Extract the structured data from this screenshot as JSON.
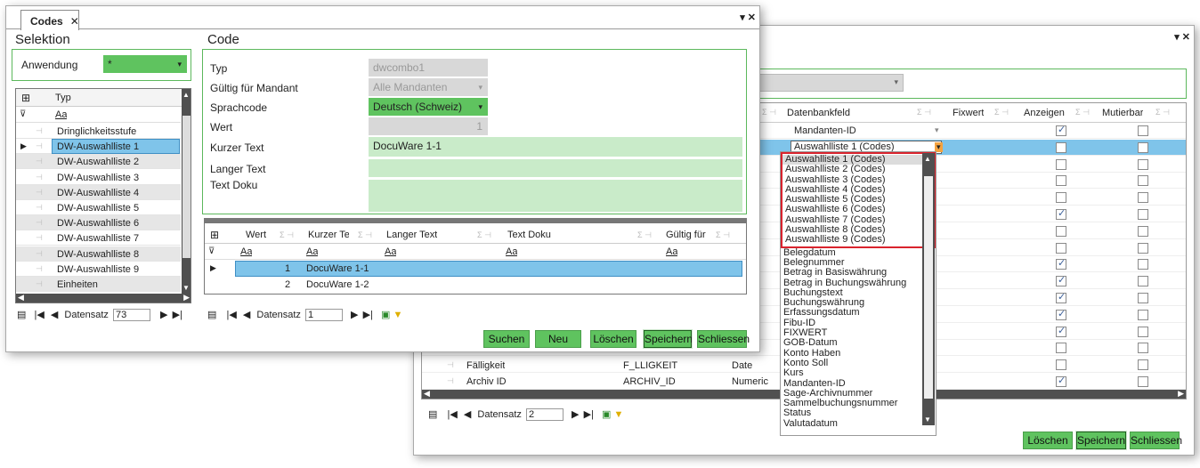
{
  "back_window": {
    "window_controls": "▾ ✕",
    "grid": {
      "columns": [
        {
          "label": "Datenbankfeld"
        },
        {
          "label": "Fixwert"
        },
        {
          "label": "Anzeigen"
        },
        {
          "label": "Mutierbar"
        }
      ],
      "sigma_pin": "Σ ⊣",
      "rows": [
        {
          "db": "Mandanten-ID",
          "anzeigen": true,
          "mutierbar": false
        },
        {
          "db": "Auswahlliste 1 (Codes)",
          "anzeigen": false,
          "mutierbar": false
        },
        {
          "anzeigen": false,
          "mutierbar": false
        },
        {
          "anzeigen": false,
          "mutierbar": false
        },
        {
          "anzeigen": false,
          "mutierbar": false
        },
        {
          "anzeigen": true,
          "mutierbar": false
        },
        {
          "anzeigen": false,
          "mutierbar": false
        },
        {
          "anzeigen": false,
          "mutierbar": false
        },
        {
          "anzeigen": true,
          "mutierbar": false
        },
        {
          "anzeigen": true,
          "mutierbar": false
        },
        {
          "anzeigen": true,
          "mutierbar": false
        },
        {
          "anzeigen": true,
          "mutierbar": false
        },
        {
          "anzeigen": true,
          "mutierbar": false
        },
        {
          "anzeigen": false,
          "mutierbar": false
        },
        {
          "anzeigen": false,
          "mutierbar": false
        },
        {
          "anzeigen": true,
          "mutierbar": false
        },
        {
          "anzeigen": true,
          "mutierbar": false
        }
      ],
      "visible_rows": [
        {
          "name": "Fälligkeit",
          "field": "F_LLIGKEIT",
          "type": "Date"
        },
        {
          "name": "Archiv ID",
          "field": "ARCHIV_ID",
          "type": "Numeric"
        }
      ]
    },
    "dropdown": {
      "highlighted": [
        "Auswahlliste 1 (Codes)",
        "Auswahlliste 2 (Codes)",
        "Auswahlliste 3 (Codes)",
        "Auswahlliste 4 (Codes)",
        "Auswahlliste 5 (Codes)",
        "Auswahlliste 6 (Codes)",
        "Auswahlliste 7 (Codes)",
        "Auswahlliste 8 (Codes)",
        "Auswahlliste 9 (Codes)"
      ],
      "rest": [
        "Belegdatum",
        "Belegnummer",
        "Betrag in Basiswährung",
        "Betrag in Buchungswährung",
        "Buchungstext",
        "Buchungswährung",
        "Erfassungsdatum",
        "Fibu-ID",
        "FIXWERT",
        "GOB-Datum",
        "Konto Haben",
        "Konto Soll",
        "Kurs",
        "Mandanten-ID",
        "Sage-Archivnummer",
        "Sammelbuchungsnummer",
        "Status",
        "Valutadatum"
      ]
    },
    "nav": {
      "label": "Datensatz",
      "value": "2"
    },
    "buttons": {
      "loeschen": "Löschen",
      "speichern": "Speichern",
      "schliessen": "Schliessen"
    }
  },
  "front_window": {
    "tab": {
      "label": "Codes",
      "close": "✕"
    },
    "window_controls": "▾ ✕",
    "selektion": {
      "title": "Selektion",
      "anwendung_label": "Anwendung",
      "anwendung_value": "*",
      "grid_header": "Typ",
      "filter": "Aa",
      "items": [
        "Dringlichkeitsstufe",
        "DW-Auswahlliste 1",
        "DW-Auswahlliste 2",
        "DW-Auswahlliste 3",
        "DW-Auswahlliste 4",
        "DW-Auswahlliste 5",
        "DW-Auswahlliste 6",
        "DW-Auswahlliste 7",
        "DW-Auswahlliste 8",
        "DW-Auswahlliste 9",
        "Einheiten"
      ],
      "nav": {
        "label": "Datensatz",
        "value": "73"
      }
    },
    "code": {
      "title": "Code",
      "typ_label": "Typ",
      "typ_value": "dwcombo1",
      "gueltig_label": "Gültig für Mandant",
      "gueltig_value": "Alle Mandanten",
      "sprach_label": "Sprachcode",
      "sprach_value": "Deutsch (Schweiz)",
      "wert_label": "Wert",
      "wert_value": "1",
      "kurz_label": "Kurzer Text",
      "kurz_value": "DocuWare 1-1",
      "lang_label": "Langer Text",
      "doku_label": "Text Doku",
      "grid": {
        "columns": [
          "Wert",
          "Kurzer Te",
          "Langer Text",
          "Text Doku",
          "Gültig für"
        ],
        "filter": "Aa",
        "rows": [
          {
            "wert": "1",
            "kurz": "DocuWare 1-1"
          },
          {
            "wert": "2",
            "kurz": "DocuWare 1-2"
          }
        ]
      },
      "nav": {
        "label": "Datensatz",
        "value": "1"
      }
    },
    "buttons": {
      "suchen": "Suchen",
      "neu": "Neu",
      "loeschen": "Löschen",
      "speichern": "Speichern",
      "schliessen": "Schliessen"
    }
  }
}
